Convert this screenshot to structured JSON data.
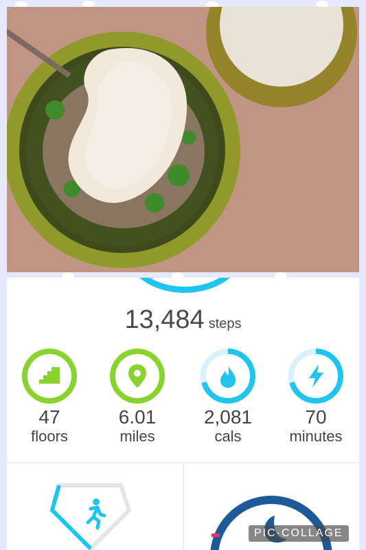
{
  "summary": {
    "steps_value": "13,484",
    "steps_unit": "steps"
  },
  "stats": [
    {
      "value": "47",
      "label": "floors",
      "icon": "stairs-icon",
      "color": "#8ad22e",
      "progress": 1.0
    },
    {
      "value": "6.01",
      "label": "miles",
      "icon": "location-pin-icon",
      "color": "#8ad22e",
      "progress": 1.0
    },
    {
      "value": "2,081",
      "label": "cals",
      "icon": "flame-icon",
      "color": "#1fc4ef",
      "progress": 0.7
    },
    {
      "value": "70",
      "label": "minutes",
      "icon": "lightning-icon",
      "color": "#1fc4ef",
      "progress": 0.7
    }
  ],
  "tiles": {
    "left_icon": "running-person-icon",
    "right_icon": "moon-icon"
  },
  "watermark": "PIC·COLLAGE",
  "colors": {
    "green": "#8ad22e",
    "blue": "#1fc4ef",
    "navy": "#1c5a9a",
    "pink": "#e8336b"
  }
}
